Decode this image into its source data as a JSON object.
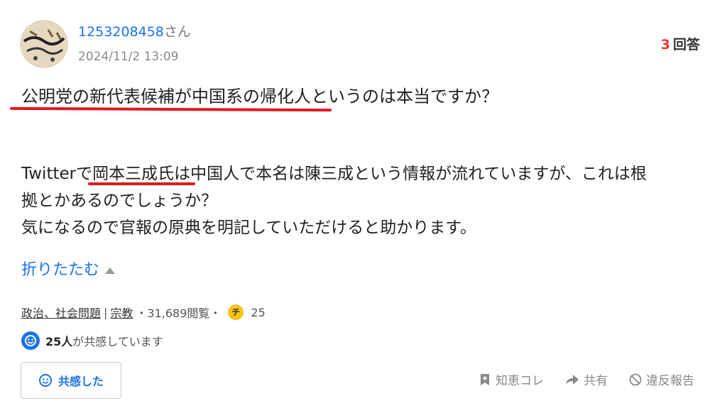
{
  "user": {
    "name": "1253208458",
    "suffix": "さん",
    "date": "2024/11/2 13:09"
  },
  "answers": {
    "count": "3",
    "label": "回答"
  },
  "title": "公明党の新代表候補が中国系の帰化人というのは本当ですか？",
  "body": {
    "line1": "Twitterで岡本三成氏は中国人で本名は陳三成という情報が流れていますが、これは根",
    "line2": "拠とかあるのでしょうか？",
    "line3": "気になるので官報の原典を明記していただけると助かります。"
  },
  "collapse_label": "折りたたむ",
  "meta": {
    "category1": "政治、社会問題",
    "separator": "|",
    "category2": "宗教",
    "views": "・31,689閲覧・",
    "chip": "チ",
    "coins": "25"
  },
  "empathy": {
    "count": "25人",
    "text": "が共感しています"
  },
  "button_label": "共感した",
  "actions": {
    "chiebukuro": "知恵コレ",
    "share": "共有",
    "report": "違反報告"
  },
  "colors": {
    "link": "#1a73e8",
    "underline": "#e0191f",
    "accent": "#e33"
  }
}
